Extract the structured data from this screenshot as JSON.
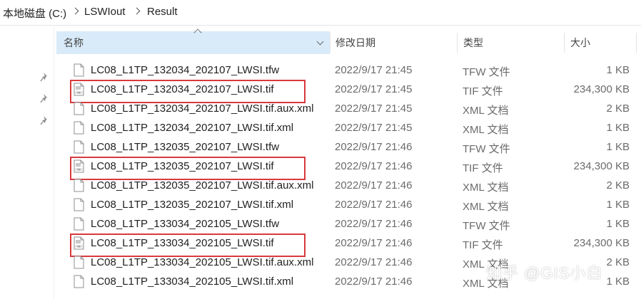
{
  "breadcrumb": {
    "drive": "本地磁盘 (C:)",
    "folder": "LSWIout",
    "current": "Result"
  },
  "columns": {
    "name": "名称",
    "date": "修改日期",
    "type": "类型",
    "size": "大小"
  },
  "files": [
    {
      "name": "LC08_L1TP_132034_202107_LWSI.tfw",
      "date": "2022/9/17 21:45",
      "type": "TFW 文件",
      "size": "1 KB",
      "icon": "generic-file-icon",
      "highlight": false
    },
    {
      "name": "LC08_L1TP_132034_202107_LWSI.tif",
      "date": "2022/9/17 21:45",
      "type": "TIF 文件",
      "size": "234,300 KB",
      "icon": "tif-file-icon",
      "highlight": true
    },
    {
      "name": "LC08_L1TP_132034_202107_LWSI.tif.aux.xml",
      "date": "2022/9/17 21:45",
      "type": "XML 文档",
      "size": "2 KB",
      "icon": "generic-file-icon",
      "highlight": false
    },
    {
      "name": "LC08_L1TP_132034_202107_LWSI.tif.xml",
      "date": "2022/9/17 21:45",
      "type": "XML 文档",
      "size": "1 KB",
      "icon": "generic-file-icon",
      "highlight": false
    },
    {
      "name": "LC08_L1TP_132035_202107_LWSI.tfw",
      "date": "2022/9/17 21:46",
      "type": "TFW 文件",
      "size": "1 KB",
      "icon": "generic-file-icon",
      "highlight": false
    },
    {
      "name": "LC08_L1TP_132035_202107_LWSI.tif",
      "date": "2022/9/17 21:46",
      "type": "TIF 文件",
      "size": "234,300 KB",
      "icon": "tif-file-icon",
      "highlight": true
    },
    {
      "name": "LC08_L1TP_132035_202107_LWSI.tif.aux.xml",
      "date": "2022/9/17 21:46",
      "type": "XML 文档",
      "size": "2 KB",
      "icon": "generic-file-icon",
      "highlight": false
    },
    {
      "name": "LC08_L1TP_132035_202107_LWSI.tif.xml",
      "date": "2022/9/17 21:46",
      "type": "XML 文档",
      "size": "1 KB",
      "icon": "generic-file-icon",
      "highlight": false
    },
    {
      "name": "LC08_L1TP_133034_202105_LWSI.tfw",
      "date": "2022/9/17 21:46",
      "type": "TFW 文件",
      "size": "1 KB",
      "icon": "generic-file-icon",
      "highlight": false
    },
    {
      "name": "LC08_L1TP_133034_202105_LWSI.tif",
      "date": "2022/9/17 21:46",
      "type": "TIF 文件",
      "size": "234,300 KB",
      "icon": "tif-file-icon",
      "highlight": true
    },
    {
      "name": "LC08_L1TP_133034_202105_LWSI.tif.aux.xml",
      "date": "2022/9/17 21:46",
      "type": "XML 文档",
      "size": "2 KB",
      "icon": "generic-file-icon",
      "highlight": false
    },
    {
      "name": "LC08_L1TP_133034_202105_LWSI.tif.xml",
      "date": "2022/9/17 21:46",
      "type": "XML 文档",
      "size": "1 KB",
      "icon": "generic-file-icon",
      "highlight": false
    }
  ],
  "watermark": "知乎 @GIS小白",
  "colors": {
    "header_selected": "#d9ebf9",
    "highlight_border": "#d9393c",
    "secondary_text": "#6b6b6b"
  }
}
